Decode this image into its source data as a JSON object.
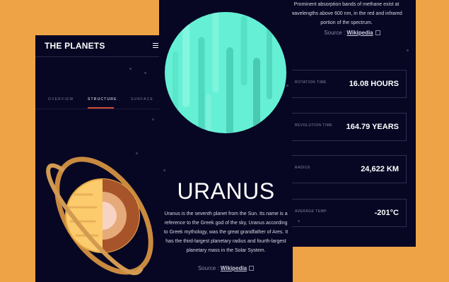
{
  "left_screen": {
    "brand": "THE PLANETS",
    "tabs": [
      {
        "label": "OVERVIEW"
      },
      {
        "label": "STRUCTURE"
      },
      {
        "label": "SURFACE"
      }
    ]
  },
  "center_screen": {
    "planet_name": "URANUS",
    "description": "Uranus is the seventh planet from the Sun. Its name is a reference to the Greek god of the sky, Uranus according to Greek mythology, was the great grandfather of Ares. It has the third-largest planetary radius and fourth-largest planetary mass in the Solar System.",
    "source_prefix": "Source : ",
    "source_link": "Wikipedia"
  },
  "right_screen": {
    "top_text": "Prominent absorption bands of methane exist at wavelengths above 600 nm, in the red and infrared portion of the spectrum.",
    "source_prefix": "Source : ",
    "source_link": "Wikipedia",
    "stats": [
      {
        "label": "ROTATION TIME",
        "value": "16.08 HOURS"
      },
      {
        "label": "REVOLUTION TIME",
        "value": "164.79 YEARS"
      },
      {
        "label": "RADIUS",
        "value": "24,622 KM"
      },
      {
        "label": "AVERAGE TEMP.",
        "value": "-201°C"
      }
    ]
  },
  "colors": {
    "background": "#EFA347",
    "screen": "#070724",
    "accent": "#D14C32",
    "uranus_teal": "#65F0D5",
    "saturn_tan": "#FCCB6B"
  }
}
